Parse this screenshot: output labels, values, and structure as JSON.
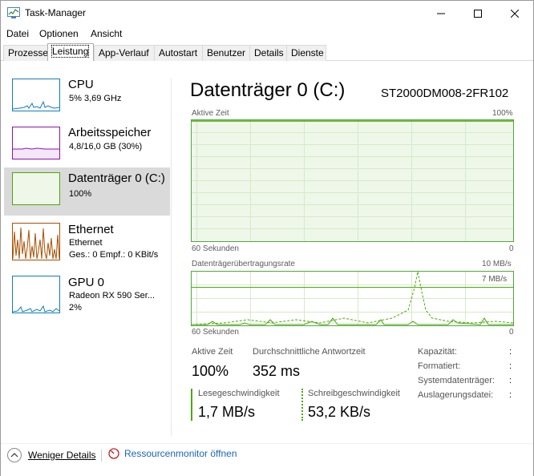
{
  "window": {
    "title": "Task-Manager"
  },
  "menu": [
    {
      "label": "Datei"
    },
    {
      "label": "Optionen"
    },
    {
      "label": "Ansicht"
    }
  ],
  "tabs": [
    {
      "label": "Prozesse"
    },
    {
      "label": "Leistung"
    },
    {
      "label": "App-Verlauf"
    },
    {
      "label": "Autostart"
    },
    {
      "label": "Benutzer"
    },
    {
      "label": "Details"
    },
    {
      "label": "Dienste"
    }
  ],
  "sidebar": {
    "items": [
      {
        "name": "CPU",
        "sub1": "5% 3,69 GHz",
        "color": "#117dbb"
      },
      {
        "name": "Arbeitsspeicher",
        "sub1": "4,8/16,0 GB (30%)",
        "color": "#8b12ae"
      },
      {
        "name": "Datenträger 0 (C:)",
        "sub1": "100%",
        "color": "#4da60c"
      },
      {
        "name": "Ethernet",
        "sub1": "Ethernet",
        "sub2": "Ges.: 0 Empf.: 0 KBit/s",
        "color": "#a74f01"
      },
      {
        "name": "GPU 0",
        "sub1": "Radeon RX 590 Ser...",
        "sub2": "2%",
        "color": "#117dbb"
      }
    ]
  },
  "main": {
    "title": "Datenträger 0 (C:)",
    "model": "ST2000DM008-2FR102",
    "graph1": {
      "label": "Aktive Zeit",
      "max": "100%",
      "xlabel": "60 Sekunden",
      "min": "0",
      "active_percent": 100
    },
    "graph2": {
      "label": "Datenträgerübertragungsrate",
      "max": "10 MB/s",
      "marker": "7 MB/s",
      "xlabel": "60 Sekunden",
      "min": "0"
    },
    "stats": {
      "active_label": "Aktive Zeit",
      "active_value": "100%",
      "response_label": "Durchschnittliche Antwortzeit",
      "response_value": "352 ms",
      "read_label": "Lesegeschwindigkeit",
      "read_value": "1,7 MB/s",
      "write_label": "Schreibgeschwindigkeit",
      "write_value": "53,2 KB/s"
    },
    "properties": [
      {
        "key": "Kapazität:",
        "value": ":"
      },
      {
        "key": "Formatiert:",
        "value": ":"
      },
      {
        "key": "Systemdatenträger:",
        "value": ":"
      },
      {
        "key": "Auslagerungsdatei:",
        "value": ":"
      }
    ]
  },
  "footer": {
    "fewer_details": "Weniger Details",
    "resource_monitor": "Ressourcenmonitor öffnen"
  },
  "colors": {
    "disk": "#4da60c",
    "disk_fill": "#eff7e9",
    "link": "#1a66b3"
  }
}
